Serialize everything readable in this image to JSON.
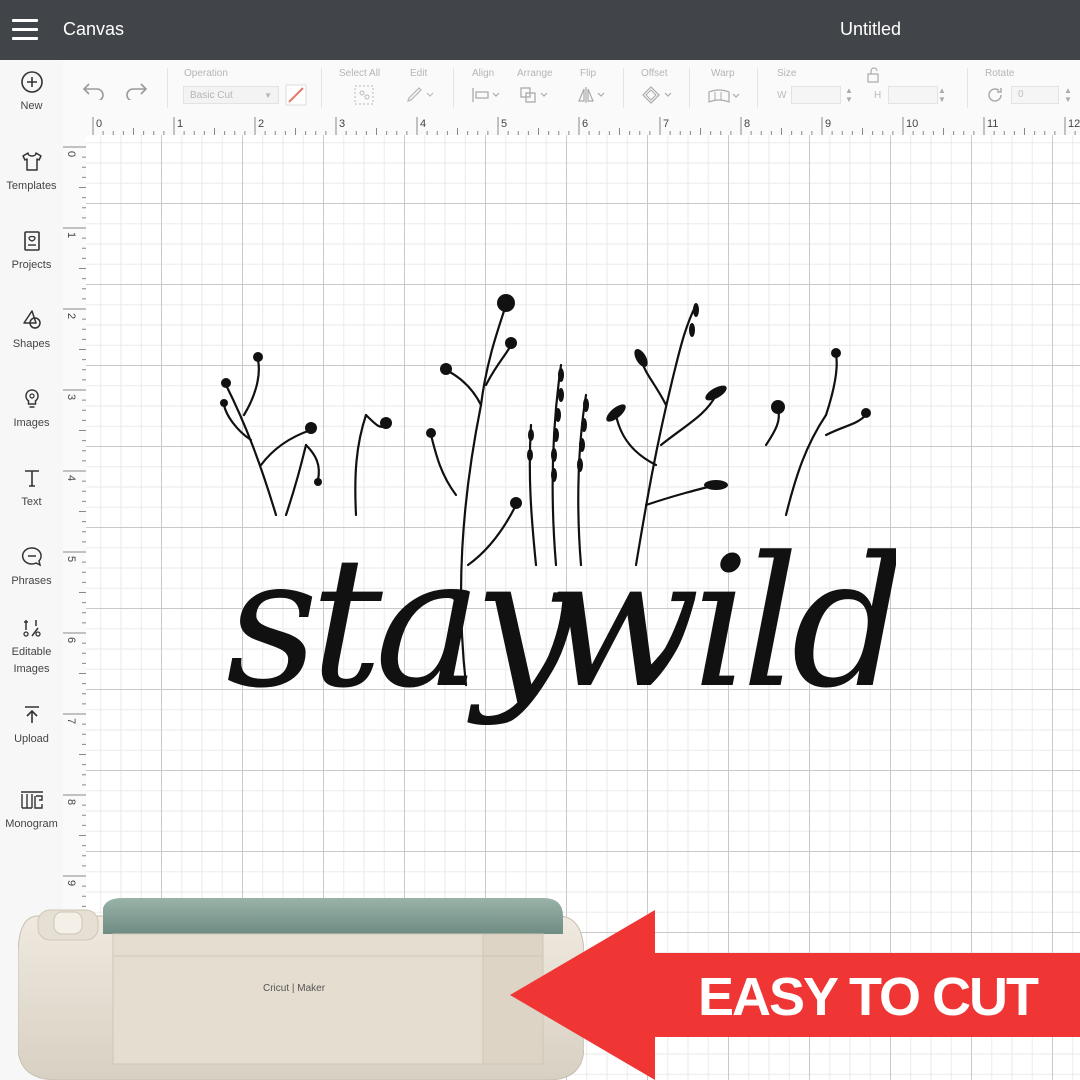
{
  "header": {
    "app_title": "Canvas",
    "document_title": "Untitled"
  },
  "sidebar": {
    "items": [
      {
        "id": "new",
        "label": "New",
        "icon": "plus-circle-icon"
      },
      {
        "id": "templates",
        "label": "Templates",
        "icon": "tshirt-icon"
      },
      {
        "id": "projects",
        "label": "Projects",
        "icon": "projects-icon"
      },
      {
        "id": "shapes",
        "label": "Shapes",
        "icon": "shapes-icon"
      },
      {
        "id": "images",
        "label": "Images",
        "icon": "lightbulb-icon"
      },
      {
        "id": "text",
        "label": "Text",
        "icon": "text-icon"
      },
      {
        "id": "phrases",
        "label": "Phrases",
        "icon": "speech-bubble-icon"
      },
      {
        "id": "editable",
        "label": "Editable\nImages",
        "icon": "editable-images-icon"
      },
      {
        "id": "upload",
        "label": "Upload",
        "icon": "upload-icon"
      },
      {
        "id": "monogram",
        "label": "Monogram",
        "icon": "monogram-icon"
      }
    ]
  },
  "toolbar": {
    "operation_label": "Operation",
    "operation_value": "Basic Cut",
    "select_all_label": "Select All",
    "edit_label": "Edit",
    "align_label": "Align",
    "arrange_label": "Arrange",
    "flip_label": "Flip",
    "offset_label": "Offset",
    "warp_label": "Warp",
    "size_label": "Size",
    "width_letter": "W",
    "height_letter": "H",
    "rotate_label": "Rotate",
    "rotate_value": "0"
  },
  "ruler": {
    "top_ticks": [
      "0",
      "1",
      "2",
      "3",
      "4",
      "5",
      "6",
      "7",
      "8",
      "9",
      "10",
      "11",
      "12"
    ],
    "left_ticks": [
      "0",
      "1",
      "2",
      "3",
      "4",
      "5",
      "6",
      "7",
      "8",
      "9"
    ]
  },
  "design": {
    "word1": "stay",
    "word2": "wild"
  },
  "machine": {
    "brand": "Cricut",
    "model": "Maker"
  },
  "badge": {
    "text": "EASY TO CUT",
    "color": "#f03535"
  },
  "colors": {
    "topbar": "#414549",
    "accent": "#f03535",
    "machine_lid": "#7d9a8f"
  }
}
